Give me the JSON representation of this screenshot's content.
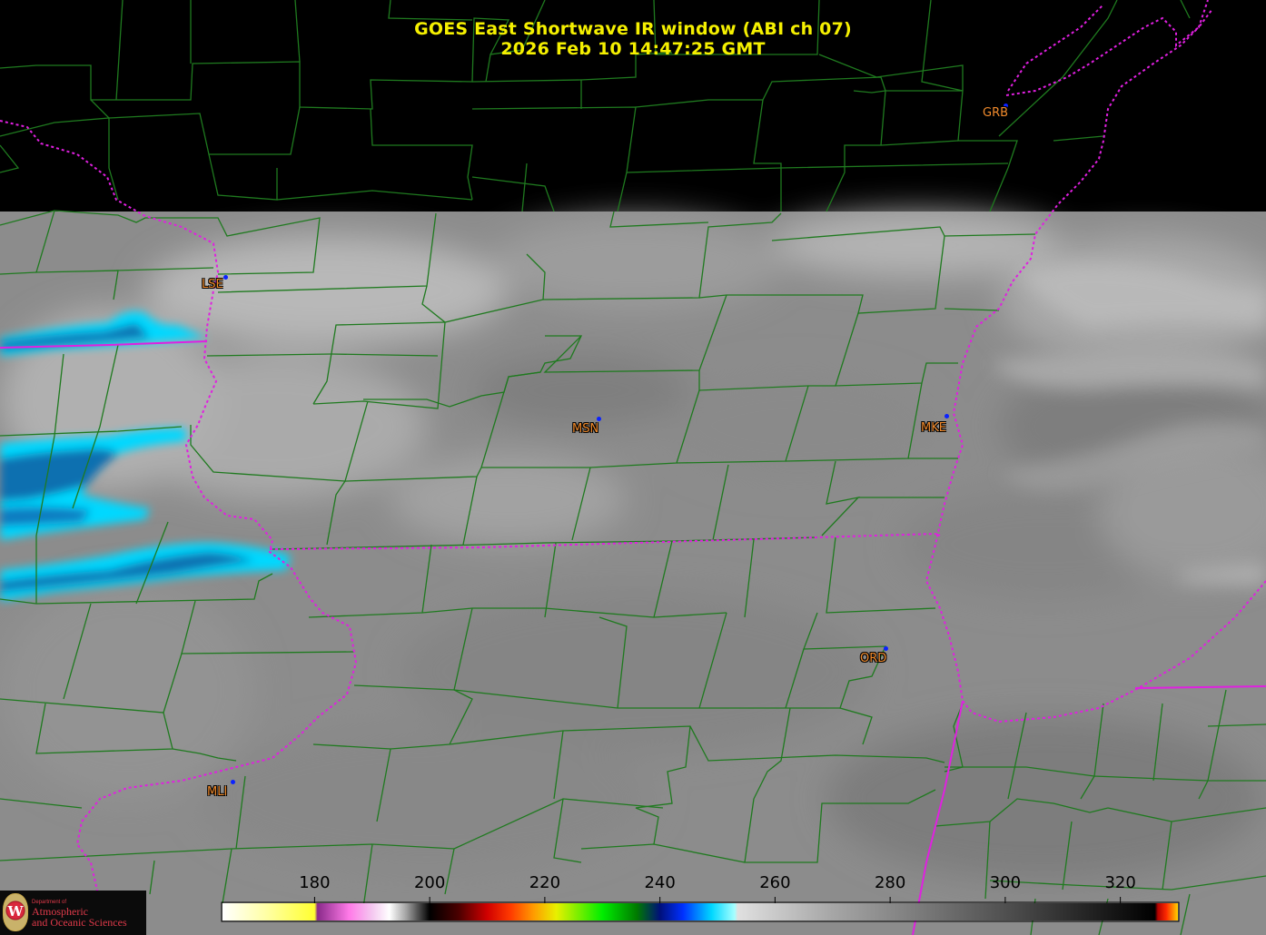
{
  "title": {
    "line1": "GOES East Shortwave IR window (ABI ch 07)",
    "line2": "2026 Feb 10  14:47:25 GMT"
  },
  "cities": [
    {
      "code": "GRB"
    },
    {
      "code": "LSE"
    },
    {
      "code": "MSN"
    },
    {
      "code": "MKE"
    },
    {
      "code": "ORD"
    },
    {
      "code": "MLI"
    }
  ],
  "colorbar": {
    "ticks": [
      "180",
      "200",
      "220",
      "240",
      "260",
      "280",
      "300",
      "320"
    ],
    "tick_values": [
      180,
      200,
      220,
      240,
      260,
      280,
      300,
      320
    ],
    "range": [
      164,
      330
    ],
    "stops": [
      {
        "v": 164,
        "c": "#ffffff"
      },
      {
        "v": 172,
        "c": "#ffffa0"
      },
      {
        "v": 180,
        "c": "#ffff30"
      },
      {
        "v": 180.5,
        "c": "#8a2a8a"
      },
      {
        "v": 186,
        "c": "#ff7ae8"
      },
      {
        "v": 190,
        "c": "#f4c8f0"
      },
      {
        "v": 193,
        "c": "#ffffff"
      },
      {
        "v": 196,
        "c": "#a0a0a0"
      },
      {
        "v": 200,
        "c": "#000000"
      },
      {
        "v": 205,
        "c": "#4a0000"
      },
      {
        "v": 210,
        "c": "#d00000"
      },
      {
        "v": 214,
        "c": "#ff3a00"
      },
      {
        "v": 218,
        "c": "#ff9a00"
      },
      {
        "v": 222,
        "c": "#e8f000"
      },
      {
        "v": 230,
        "c": "#00ee00"
      },
      {
        "v": 236,
        "c": "#007a00"
      },
      {
        "v": 240,
        "c": "#00107a"
      },
      {
        "v": 244,
        "c": "#0030ff"
      },
      {
        "v": 249,
        "c": "#00d8ff"
      },
      {
        "v": 253,
        "c": "#a8ffff"
      },
      {
        "v": 253.5,
        "c": "#e0e0e0"
      },
      {
        "v": 270,
        "c": "#a6a6a6"
      },
      {
        "v": 300,
        "c": "#505050"
      },
      {
        "v": 322,
        "c": "#0c0c0c"
      },
      {
        "v": 326,
        "c": "#000000"
      },
      {
        "v": 326.5,
        "c": "#b00000"
      },
      {
        "v": 328,
        "c": "#ff2a00"
      },
      {
        "v": 330,
        "c": "#ffd200"
      }
    ]
  },
  "colors": {
    "background": "#000000",
    "title": "#f5f000",
    "county_lines": "#1f7a1f",
    "state_lines": "#e020e0",
    "city_label": "#f08a2c",
    "city_dot": "#0b22ff",
    "cold_cloud": "#00d8ff",
    "deep_cold_cloud": "#0a6fb0"
  },
  "logo": {
    "seal": "W",
    "dept": "Department of",
    "line1": "Atmospheric",
    "line2": "and Oceanic Sciences"
  }
}
